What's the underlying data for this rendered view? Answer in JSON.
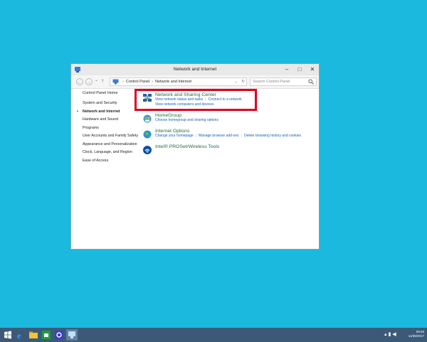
{
  "window": {
    "title": "Network and Internet",
    "minimize": "–",
    "maximize": "□",
    "close": "✕"
  },
  "address": {
    "back": "←",
    "forward": "→",
    "recent": "⌄",
    "up": "↑",
    "breadcrumb_root": "Control Panel",
    "breadcrumb_current": "Network and Internet",
    "dropdown": "⌄",
    "refresh": "↻"
  },
  "search": {
    "placeholder": "Search Control Panel"
  },
  "sidebar": {
    "home": "Control Panel Home",
    "items": [
      {
        "label": "System and Security"
      },
      {
        "label": "Network and Internet"
      },
      {
        "label": "Hardware and Sound"
      },
      {
        "label": "Programs"
      },
      {
        "label": "User Accounts and Family Safety"
      },
      {
        "label": "Appearance and Personalization"
      },
      {
        "label": "Clock, Language, and Region"
      },
      {
        "label": "Ease of Access"
      }
    ]
  },
  "categories": [
    {
      "title": "Network and Sharing Center",
      "icon": "network-icon",
      "links_row1": [
        "View network status and tasks",
        "Connect to a network"
      ],
      "links_row2": [
        "View network computers and devices"
      ]
    },
    {
      "title": "HomeGroup",
      "icon": "homegroup-icon",
      "links_row1": [
        "Choose homegroup and sharing options"
      ]
    },
    {
      "title": "Internet Options",
      "icon": "globe-icon",
      "links_row1": [
        "Change your homepage",
        "Manage browser add-ons",
        "Delete browsing history and cookies"
      ]
    },
    {
      "title": "Intel® PROSet/Wireless Tools",
      "icon": "wireless-icon"
    }
  ],
  "taskbar": {
    "time": "09:46",
    "date": "11/08/2017"
  },
  "colors": {
    "desktop": "#1ab9dd",
    "link": "#1a5fb4",
    "category_title": "#1e6e3b",
    "highlight": "#e1001a",
    "taskbar": "#3c5a78"
  }
}
